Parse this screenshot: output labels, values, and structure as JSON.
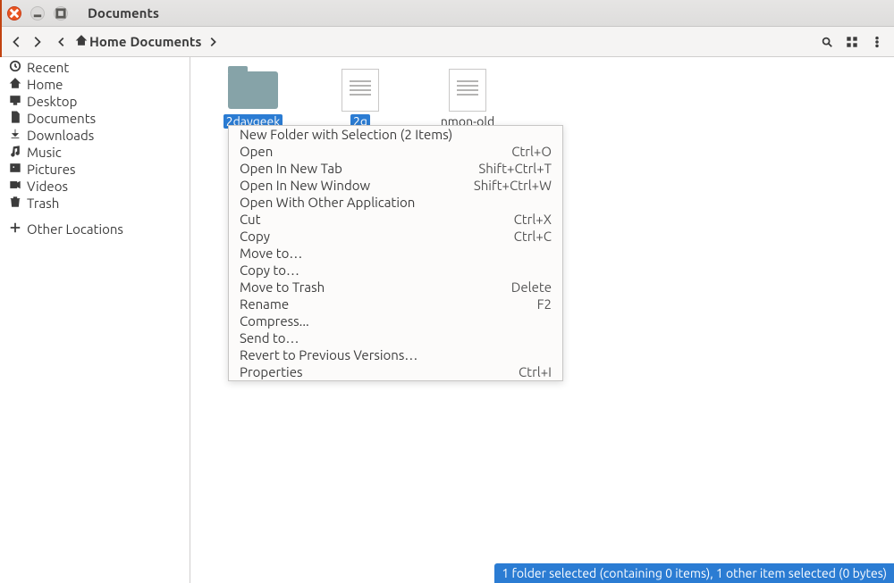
{
  "window": {
    "title": "Documents"
  },
  "path": {
    "segments": [
      "Home",
      "Documents"
    ]
  },
  "sidebar": [
    {
      "icon": "clock-icon",
      "label": "Recent"
    },
    {
      "icon": "home-icon",
      "label": "Home"
    },
    {
      "icon": "desktop-icon",
      "label": "Desktop"
    },
    {
      "icon": "document-icon",
      "label": "Documents"
    },
    {
      "icon": "download-icon",
      "label": "Downloads"
    },
    {
      "icon": "music-icon",
      "label": "Music"
    },
    {
      "icon": "pictures-icon",
      "label": "Pictures"
    },
    {
      "icon": "video-icon",
      "label": "Videos"
    },
    {
      "icon": "trash-icon",
      "label": "Trash"
    },
    {
      "icon": "plus-icon",
      "label": "Other Locations"
    }
  ],
  "files": [
    {
      "name": "2daygeek",
      "type": "folder",
      "selected": true
    },
    {
      "name": "2g",
      "type": "document",
      "selected": true
    },
    {
      "name": "nmon-old",
      "type": "document",
      "selected": false
    }
  ],
  "menu": [
    {
      "label": "New Folder with Selection (2 Items)",
      "accel": ""
    },
    {
      "label": "Open",
      "accel": "Ctrl+O"
    },
    {
      "label": "Open In New Tab",
      "accel": "Shift+Ctrl+T"
    },
    {
      "label": "Open In New Window",
      "accel": "Shift+Ctrl+W"
    },
    {
      "label": "Open With Other Application",
      "accel": ""
    },
    {
      "label": "Cut",
      "accel": "Ctrl+X"
    },
    {
      "label": "Copy",
      "accel": "Ctrl+C"
    },
    {
      "label": "Move to…",
      "accel": ""
    },
    {
      "label": "Copy to…",
      "accel": ""
    },
    {
      "label": "Move to Trash",
      "accel": "Delete"
    },
    {
      "label": "Rename",
      "accel": "F2"
    },
    {
      "label": "Compress...",
      "accel": ""
    },
    {
      "label": "Send to…",
      "accel": ""
    },
    {
      "label": "Revert to Previous Versions…",
      "accel": ""
    },
    {
      "label": "Properties",
      "accel": "Ctrl+I"
    }
  ],
  "status": "1 folder selected (containing 0 items), 1 other item selected (0 bytes)",
  "colors": {
    "accent": "#2b7cd3",
    "folder": "#86a3a8",
    "ubuntu": "#e95420"
  }
}
